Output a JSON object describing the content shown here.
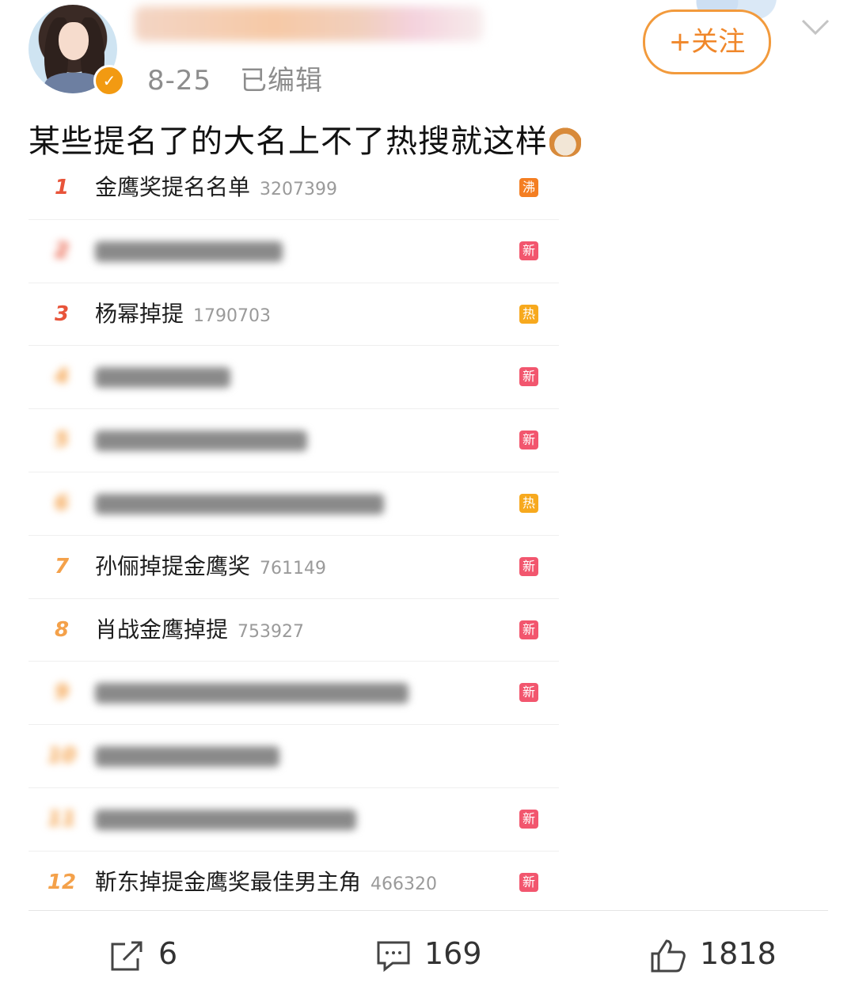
{
  "header": {
    "date": "8-25",
    "edited_label": "已编辑",
    "follow_label": "+关注"
  },
  "post": {
    "text": "某些提名了的大名上不了热搜就这样"
  },
  "colors": {
    "accent": "#f0872a",
    "badge_new": "#f2566e",
    "badge_hot": "#f7a91e",
    "badge_boil": "#f47e22"
  },
  "hot_list": [
    {
      "rank": "1",
      "title": "金鹰奖提名名单",
      "count": "3207399",
      "badge": "沸",
      "badge_color": "#f47e22",
      "rank_color": "#e8543a",
      "blurred": false
    },
    {
      "rank": "2",
      "title": "",
      "count": "",
      "badge": "新",
      "badge_color": "#f2566e",
      "rank_color": "#e8543a",
      "blurred": true
    },
    {
      "rank": "3",
      "title": "杨幂掉提",
      "count": "1790703",
      "badge": "热",
      "badge_color": "#f7a91e",
      "rank_color": "#e8543a",
      "blurred": false
    },
    {
      "rank": "4",
      "title": "",
      "count": "",
      "badge": "新",
      "badge_color": "#f2566e",
      "rank_color": "#f4a14a",
      "blurred": true
    },
    {
      "rank": "5",
      "title": "",
      "count": "",
      "badge": "新",
      "badge_color": "#f2566e",
      "rank_color": "#f4a14a",
      "blurred": true
    },
    {
      "rank": "6",
      "title": "",
      "count": "",
      "badge": "热",
      "badge_color": "#f7a91e",
      "rank_color": "#f4a14a",
      "blurred": true
    },
    {
      "rank": "7",
      "title": "孙俪掉提金鹰奖",
      "count": "761149",
      "badge": "新",
      "badge_color": "#f2566e",
      "rank_color": "#f4a14a",
      "blurred": false
    },
    {
      "rank": "8",
      "title": "肖战金鹰掉提",
      "count": "753927",
      "badge": "新",
      "badge_color": "#f2566e",
      "rank_color": "#f4a14a",
      "blurred": false
    },
    {
      "rank": "9",
      "title": "",
      "count": "",
      "badge": "新",
      "badge_color": "#f2566e",
      "rank_color": "#f4a14a",
      "blurred": true
    },
    {
      "rank": "10",
      "title": "",
      "count": "",
      "badge": "",
      "badge_color": "",
      "rank_color": "#f4a14a",
      "blurred": true
    },
    {
      "rank": "11",
      "title": "",
      "count": "",
      "badge": "新",
      "badge_color": "#f2566e",
      "rank_color": "#f4a14a",
      "blurred": true
    },
    {
      "rank": "12",
      "title": "靳东掉提金鹰奖最佳男主角",
      "count": "466320",
      "badge": "新",
      "badge_color": "#f2566e",
      "rank_color": "#f4a14a",
      "blurred": false
    }
  ],
  "actions": {
    "share_count": "6",
    "comment_count": "169",
    "like_count": "1818"
  },
  "icons": [
    "avatar",
    "verified-badge-icon",
    "chevron-down-icon",
    "cat-emoji-icon",
    "share-icon",
    "comment-icon",
    "like-icon"
  ]
}
